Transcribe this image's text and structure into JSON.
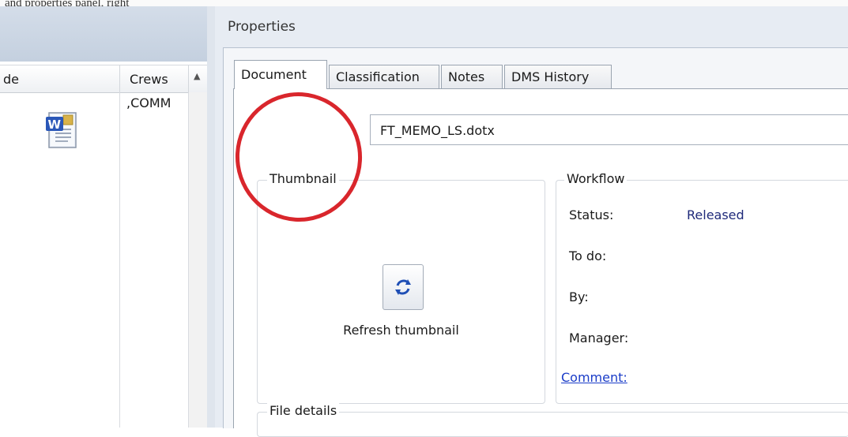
{
  "top_caption": "and properties panel, right",
  "left_grid": {
    "columns": [
      "de",
      "Crews"
    ],
    "rows": [
      {
        "crews": ",COMM"
      }
    ]
  },
  "properties": {
    "title": "Properties",
    "tabs": [
      "Document",
      "Classification",
      "Notes",
      "DMS History"
    ],
    "active_tab": "Document",
    "filename": "FT_MEMO_LS.dotx",
    "thumbnail": {
      "legend": "Thumbnail",
      "refresh_label": "Refresh thumbnail"
    },
    "workflow": {
      "legend": "Workflow",
      "status_label": "Status:",
      "status_value": "Released",
      "todo_label": "To do:",
      "by_label": "By:",
      "manager_label": "Manager:",
      "comment_link": "Comment:"
    },
    "file_details": {
      "legend": "File details"
    }
  },
  "colors": {
    "highlight_circle": "#d9262c",
    "status_value": "#1f2a7a",
    "link": "#1a3cc8"
  },
  "icons": {
    "file": "word-document-icon",
    "refresh": "refresh-icon",
    "sort": "sort-up-icon"
  }
}
